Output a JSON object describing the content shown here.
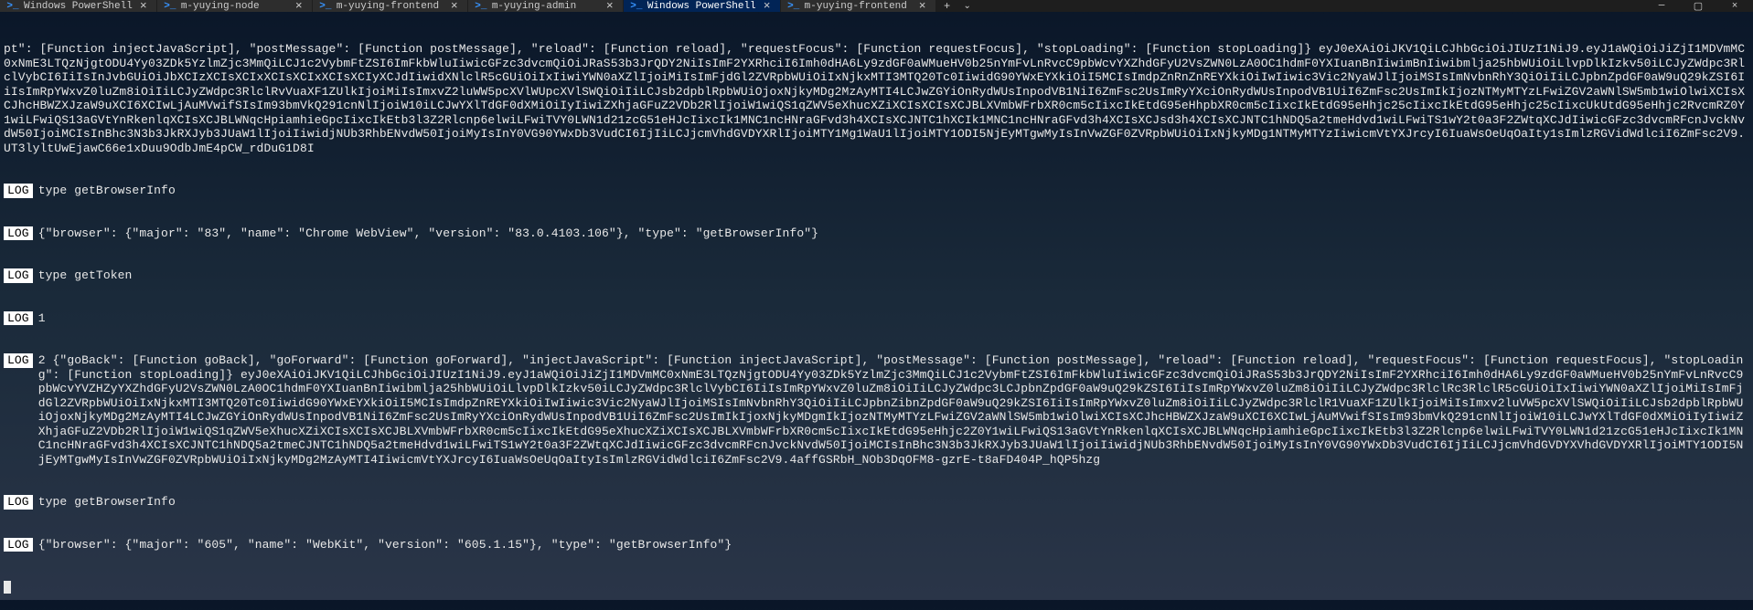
{
  "tabs": [
    {
      "label": "Windows PowerShell",
      "active": false
    },
    {
      "label": "m-yuying-node",
      "active": false
    },
    {
      "label": "m-yuying-frontend",
      "active": false
    },
    {
      "label": "m-yuying-admin",
      "active": false
    },
    {
      "label": "Windows PowerShell",
      "active": true
    },
    {
      "label": "m-yuying-frontend",
      "active": false
    }
  ],
  "terminal": {
    "block1": "pt\": [Function injectJavaScript], \"postMessage\": [Function postMessage], \"reload\": [Function reload], \"requestFocus\": [Function requestFocus], \"stopLoading\": [Function stopLoading]} eyJ0eXAiOiJKV1QiLCJhbGciOiJIUzI1NiJ9.eyJ1aWQiOiJiZjI1MDVmMC0xNmE3LTQzNjgtODU4Yy03ZDk5YzlmZjc3MmQiLCJ1c2VybmFtZSI6ImFkbWluIiwicGFzc3dvcmQiOiJRaS53b3JrQDY2NiIsImF2YXRhciI6Imh0dHA6Ly9zdGF0aWMueHV0b25nYmFvLnRvcC9pbWcvYXZhdGFyU2VsZWN0LzA0OC1hdmF0YXIuanBnIiwimBnIiwibmlja25hbWUiOiLlvpDlkIzkv50iLCJyZWdpc3RlclVybCI6IiIsInJvbGUiOiJbXCIzXCIsXCIxXCIsXCIxXCIsXCIyXCJdIiwidXNlclR5cGUiOiIxIiwiYWN0aXZlIjoiMiIsImFjdGl2ZVRpbWUiOiIxNjkxMTI3MTQ20Tc0IiwidG90YWxEYXkiOiI5MCIsImdpZnRnZnREYXkiOiIwIiwic3Vic2NyaWJlIjoiMSIsImNvbnRhY3QiOiIiLCJpbnZpdGF0aW9uQ29kZSI6IiIsImRpYWxvZ0luZm8iOiIiLCJyZWdpc3RlclRvVuaXF1ZUlkIjoiMiIsImxvZ2luWW5pcXVlWUpcXVlSWQiOiIiLCJsb2dpblRpbWUiOjoxNjkyMDg2MzAyMTI4LCJwZGYiOnRydWUsInpodVB1NiI6ZmFsc2UsImRyYXciOnRydWUsInpodVB1UiI6ZmFsc2UsImIkIjozNTMyMTYzLFwiZGV2aWNlSW5mb1wiOlwiXCIsXCJhcHBWZXJzaW9uXCI6XCIwLjAuMVwifSIsIm93bmVkQ291cnNlIjoiW10iLCJwYXlTdGF0dXMiOiIyIiwiZXhjaGFuZ2VDb2RlIjoiW1wiQS1qZWV5eXhucXZiXCIsXCIsXCJBLXVmbWFrbXR0cm5cIixcIkEtdG95eHhpbXR0cm5cIixcIkEtdG95eHhjc25cIixcIkEtdG95eHhjc25cIixcUkUtdG95eHhjc2RvcmRZ0Y1wiLFwiQS13aGVtYnRkenlqXCIsXCJBLWNqcHpiamhieGpcIixcIkEtb3l3Z2Rlcnp6elwiLFwiTVY0LWN1d21zcG51eHJcIixcIk1MNC1ncHNraGFvd3h4XCIsXCJNTC1hXCIk1MNC1ncHNraGFvd3h4XCIsXCJsd3h4XCIsXCJNTC1hNDQ5a2tmeHdvd1wiLFwiTS1wY2t0a3F2ZWtqXCJdIiwicGFzc3dvcmRFcnJvckNvdW50IjoiMCIsInBhc3N3b3JkRXJyb3JUaW1lIjoiIiwidjNUb3RhbENvdW50IjoiMyIsInY0VG90YWxDb3VudCI6IjIiLCJjcmVhdGVDYXRlIjoiMTY1Mg1WaU1lIjoiMTY1ODI5NjEyMTgwMyIsInVwZGF0ZVRpbWUiOiIxNjkyMDg1NTMyMTYzIiwicmVtYXJrcyI6IuaWsOeUqOaIty1sImlzRGVidWdlciI6ZmFsc2V9.UT3lyltUwEjawC66e1xDuu9OdbJmE4pCW_rdDuG1D8I",
    "log1": "type getBrowserInfo",
    "log2": "{\"browser\": {\"major\": \"83\", \"name\": \"Chrome WebView\", \"version\": \"83.0.4103.106\"}, \"type\": \"getBrowserInfo\"}",
    "log3": "type getToken",
    "log4": "1",
    "log5_prefix": "2 ",
    "block2": "{\"goBack\": [Function goBack], \"goForward\": [Function goForward], \"injectJavaScript\": [Function injectJavaScript], \"postMessage\": [Function postMessage], \"reload\": [Function reload], \"requestFocus\": [Function requestFocus], \"stopLoading\": [Function stopLoading]} eyJ0eXAiOiJKV1QiLCJhbGciOiJIUzI1NiJ9.eyJ1aWQiOiJiZjI1MDVmMC0xNmE3LTQzNjgtODU4Yy03ZDk5YzlmZjc3MmQiLCJ1c2VybmFtZSI6ImFkbWluIiwicGFzc3dvcmQiOiJRaS53b3JrQDY2NiIsImF2YXRhciI6Imh0dHA6Ly9zdGF0aWMueHV0b25nYmFvLnRvcC9pbWcvYVZHZyYXZhdGFyU2VsZWN0LzA0OC1hdmF0YXIuanBnIiwibmlja25hbWUiOiLlvpDlkIzkv50iLCJyZWdpc3RlclVybCI6IiIsImRpYWxvZ0luZm8iOiIiLCJyZWdpc3LCJpbnZpdGF0aW9uQ29kZSI6IiIsImRpYWxvZ0luZm8iOiIiLCJyZWdpc3RlclRc3RlclR5cGUiOiIxIiwiYWN0aXZlIjoiMiIsImFjdGl2ZVRpbWUiOiIxNjkxMTI3MTQ20Tc0IiwidG90YWxEYXkiOiI5MCIsImdpZnREYXkiOiIwIiwic3Vic2NyaWJlIjoiMSIsImNvbnRhY3QiOiIiLCJpbnZibnZpdGF0aW9uQ29kZSI6IiIsImRpYWxvZ0luZm8iOiIiLCJyZWdpc3RlclR1VuaXF1ZUlkIjoiMiIsImxv2luVW5pcXVlSWQiOiIiLCJsb2dpblRpbWUiOjoxNjkyMDg2MzAyMTI4LCJwZGYiOnRydWUsInpodVB1NiI6ZmFsc2UsImRyYXciOnRydWUsInpodVB1UiI6ZmFsc2UsImIkIjoxNjkyMDgmIkIjozNTMyMTYzLFwiZGV2aWNlSW5mb1wiOlwiXCIsXCJhcHBWZXJzaW9uXCI6XCIwLjAuMVwifSIsIm93bmVkQ291cnNlIjoiW10iLCJwYXlTdGF0dXMiOiIyIiwiZXhjaGFuZ2VDb2RlIjoiW1wiQS1qZWV5eXhucXZiXCIsXCIsXCJBLXVmbWFrbXR0cm5cIixcIkEtdG95eXhucXZiXCIsXCJBLXVmbWFrbXR0cm5cIixcIkEtdG95eHhjc2Z0Y1wiLFwiQS13aGVtYnRkenlqXCIsXCJBLWNqcHpiamhieGpcIixcIkEtb3l3Z2Rlcnp6elwiLFwiTVY0LWN1d21zcG51eHJcIixcIk1MNC1ncHNraGFvd3h4XCIsXCJNTC1hNDQ5a2tmeCJNTC1hNDQ5a2tmeHdvd1wiLFwiTS1wY2t0a3F2ZWtqXCJdIiwicGFzc3dvcmRFcnJvckNvdW50IjoiMCIsInBhc3N3b3JkRXJyb3JUaW1lIjoiIiwidjNUb3RhbENvdW50IjoiMyIsInY0VG90YWxDb3VudCI6IjIiLCJjcmVhdGVDYXVhdGVDYXRlIjoiMTY1ODI5NjEyMTgwMyIsInVwZGF0ZVRpbWUiOiIxNjkyMDg2MzAyMTI4IiwicmVtYXJrcyI6IuaWsOeUqOaItyIsImlzRGVidWdlciI6ZmFsc2V9.4affGSRbH_NOb3DqOFM8-gzrE-t8aFD404P_hQP5hzg",
    "log6": "type getBrowserInfo",
    "log7": "{\"browser\": {\"major\": \"605\", \"name\": \"WebKit\", \"version\": \"605.1.15\"}, \"type\": \"getBrowserInfo\"}",
    "log_label": "LOG"
  }
}
